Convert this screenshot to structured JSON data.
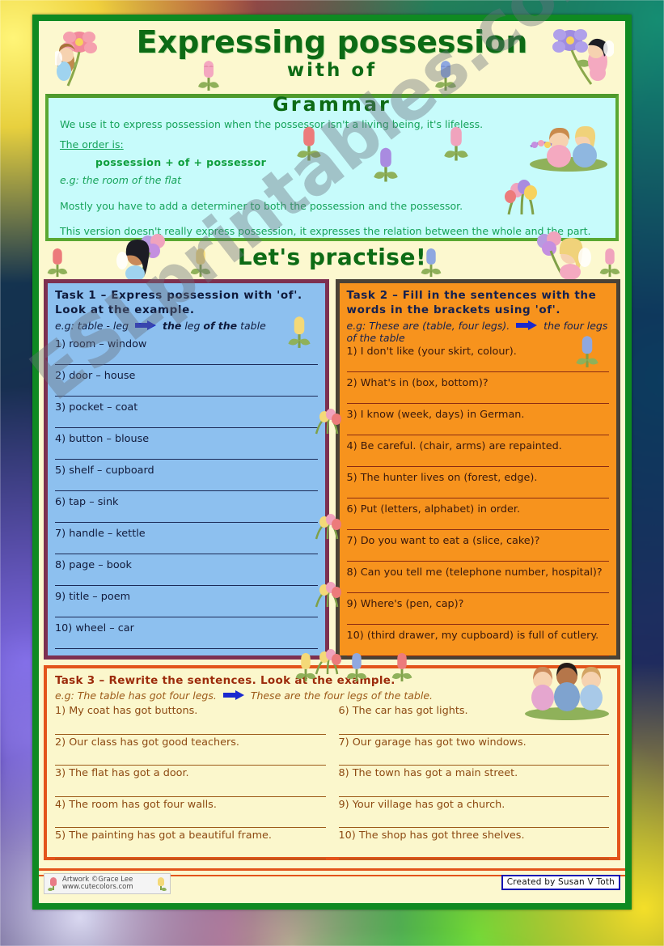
{
  "header": {
    "title_line1": "Expressing possession",
    "title_line2": "with of",
    "section_title": "Grammar"
  },
  "grammar": {
    "line1": "We use it to express possession when the possessor isn't a living being, it's lifeless.",
    "line2": "The order is:",
    "rule": "possession + of + possessor",
    "example": "e.g: the room of the flat",
    "line3": "Mostly you have to add a determiner to both the possession and the possessor.",
    "line4": "This version doesn't really express possession, it expresses the relation between the whole and the part."
  },
  "practise_banner": "Let's practise!",
  "task1": {
    "title": "Task 1 – Express possession with 'of'. Look at the example.",
    "example_prefix": "e.g: table - leg",
    "example_answer_1": "the",
    "example_answer_2": "leg",
    "example_answer_3": "of the",
    "example_answer_4": "table",
    "items": [
      "1) room – window",
      "2) door – house",
      "3) pocket – coat",
      "4) button – blouse",
      "5) shelf – cupboard",
      "6) tap – sink",
      "7) handle – kettle",
      "8) page – book",
      "9) title – poem",
      "10) wheel – car"
    ]
  },
  "task2": {
    "title": "Task 2 – Fill in the sentences with the words in the brackets using 'of'.",
    "example_prefix": "e.g: These are (table, four legs).",
    "example_answer": "the four legs of the table",
    "items": [
      "1) I don't like (your skirt, colour).",
      "2) What's in (box, bottom)?",
      "3) I know (week, days) in German.",
      "4) Be careful. (chair, arms) are repainted.",
      "5) The hunter lives on (forest, edge).",
      "6) Put (letters, alphabet) in order.",
      "7) Do you want to eat a (slice, cake)?",
      "8) Can you tell me (telephone number, hospital)?",
      "9) Where's (pen, cap)?",
      "10) (third drawer, my cupboard) is full of cutlery."
    ]
  },
  "task3": {
    "title": "Task 3 – Rewrite the sentences. Look at the example.",
    "example_prefix": "e.g: The table has got four legs.",
    "example_answer": "These are the four legs of the table.",
    "items_left": [
      "1) My coat has got buttons.",
      "2) Our class has got good teachers.",
      "3) The flat has got a door.",
      "4) The room has got four walls.",
      "5) The painting has got a beautiful frame."
    ],
    "items_right": [
      "6) The car has got lights.",
      "7) Our garage has got two windows.",
      "8) The town has got a main street.",
      "9) Your village has got a church.",
      "10) The shop has got three shelves."
    ]
  },
  "footer": {
    "artwork_line1": "Artwork ©Grace Lee",
    "artwork_line2": "www.cutecolors.com",
    "created_by": "Created by Susan V Toth"
  },
  "watermark": "ESLprintables.com",
  "colors": {
    "page_border_green": "#0f8a22",
    "sheet_cream": "#fcf8cf",
    "grammar_bg": "#c7fbfb",
    "grammar_border": "#5aa832",
    "grammar_text": "#16a35a",
    "title_green": "#0d6b15",
    "task1_bg": "#8dc0ef",
    "task1_border": "#7d3050",
    "task2_bg": "#f7931d",
    "task2_border": "#4a4236",
    "task3_border": "#e3541b",
    "task3_title": "#9c2b0b",
    "arrow_blue": "#1a29cf",
    "created_badge_border": "#1414b4"
  }
}
